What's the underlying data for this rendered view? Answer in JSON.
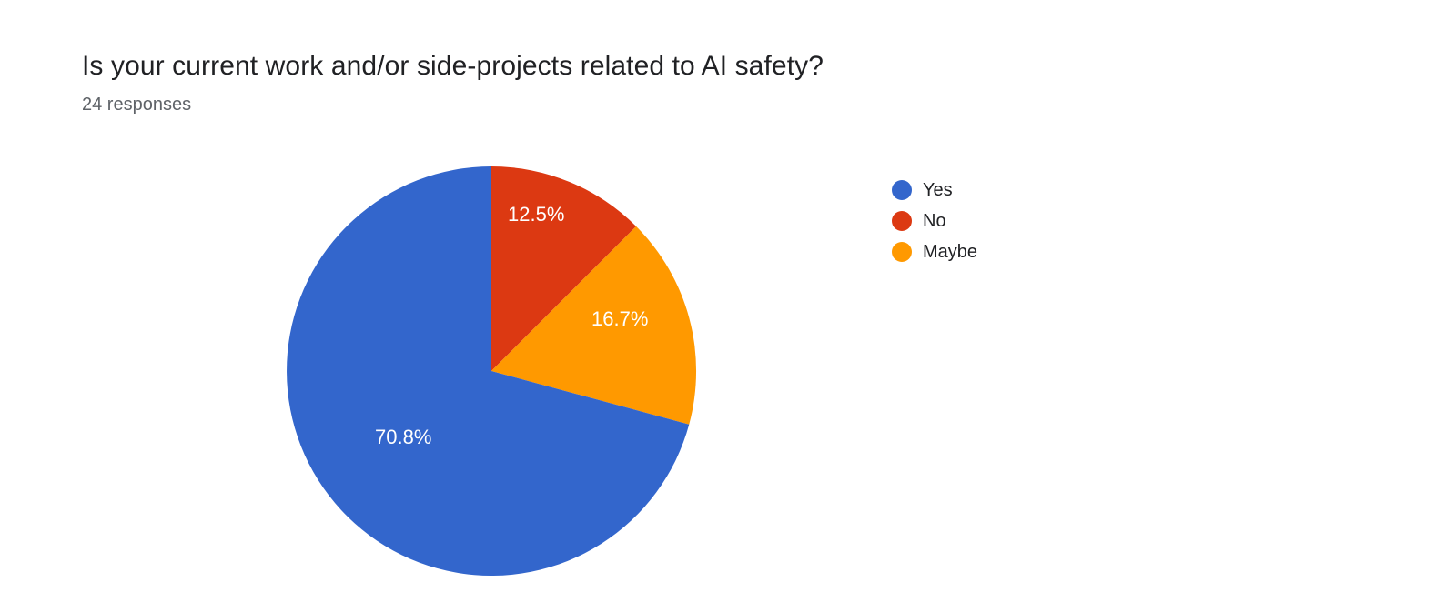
{
  "title": "Is your current work and/or side-projects related to AI safety?",
  "subtitle": "24 responses",
  "legend": {
    "items": [
      {
        "label": "Yes",
        "color": "#3366cc"
      },
      {
        "label": "No",
        "color": "#dc3912"
      },
      {
        "label": "Maybe",
        "color": "#ff9900"
      }
    ]
  },
  "slice_labels": {
    "yes": "70.8%",
    "no": "12.5%",
    "maybe": "16.7%"
  },
  "chart_data": {
    "type": "pie",
    "title": "Is your current work and/or side-projects related to AI safety?",
    "responses": 24,
    "series": [
      {
        "name": "Yes",
        "value": 70.8,
        "count": 17,
        "color": "#3366cc"
      },
      {
        "name": "No",
        "value": 12.5,
        "count": 3,
        "color": "#dc3912"
      },
      {
        "name": "Maybe",
        "value": 16.7,
        "count": 4,
        "color": "#ff9900"
      }
    ]
  }
}
